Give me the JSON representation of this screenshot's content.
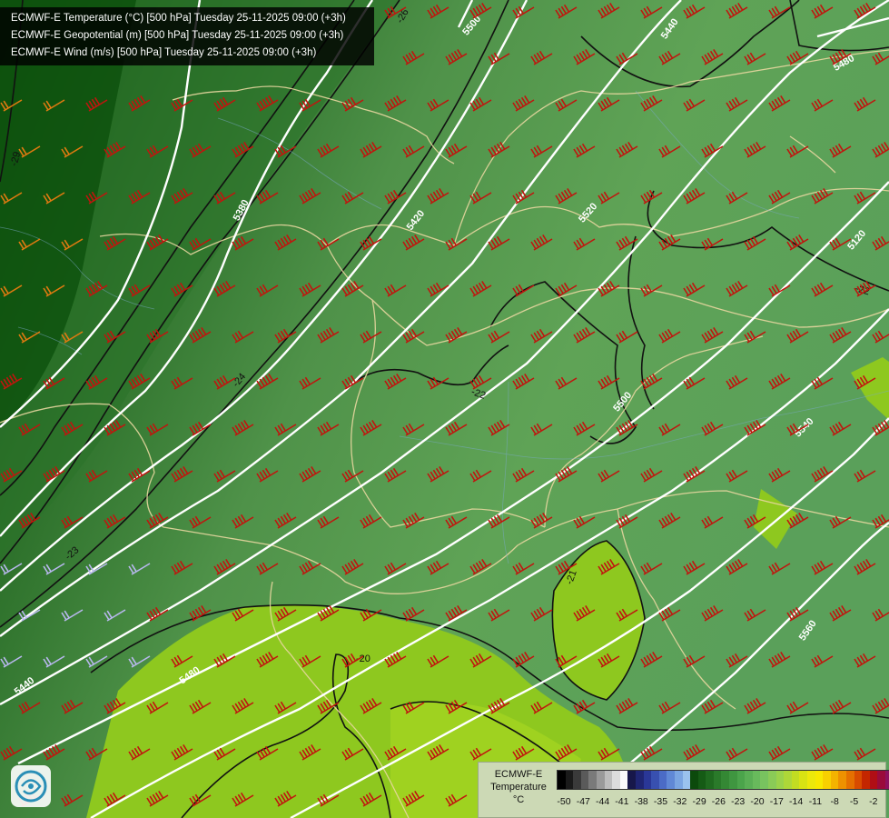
{
  "titles": [
    "ECMWF-E Temperature (°C) [500 hPa] Tuesday 25-11-2025 09:00 (+3h)",
    "ECMWF-E Geopotential (m) [500 hPa] Tuesday 25-11-2025 09:00 (+3h)",
    "ECMWF-E Wind (m/s) [500 hPa] Tuesday 25-11-2025 09:00 (+3h)"
  ],
  "legend": {
    "title_line1": "ECMWF-E",
    "title_line2": "Temperature",
    "unit": "°C",
    "ticks": [
      "-50",
      "-47",
      "-44",
      "-41",
      "-38",
      "-35",
      "-32",
      "-29",
      "-26",
      "-23",
      "-20",
      "-17",
      "-14",
      "-11",
      "-8",
      "-5",
      "-2"
    ],
    "colors": [
      "#000000",
      "#1a1a1a",
      "#3a3a3a",
      "#5a5a5a",
      "#7a7a7a",
      "#9a9a9a",
      "#bdbdbd",
      "#dcdcdc",
      "#fbfbfb",
      "#17174a",
      "#1f2573",
      "#2a3797",
      "#3850b0",
      "#4b6bc6",
      "#6088d6",
      "#7aa5e2",
      "#9ac2ee",
      "#0c4a0c",
      "#155b15",
      "#1f6a1f",
      "#2a7a2a",
      "#348834",
      "#3f9640",
      "#4ba44b",
      "#5aaf55",
      "#68ba5c",
      "#78c35f",
      "#8acb57",
      "#9bd24a",
      "#aed738",
      "#c2dc22",
      "#d8e313",
      "#ece80b",
      "#f8e800",
      "#f8d000",
      "#f4b300",
      "#ee9100",
      "#e57000",
      "#d84b00",
      "#c42600",
      "#b00e15",
      "#9a0b3b",
      "#8c1260",
      "#7e1a85",
      "#7020a8",
      "#6224c8",
      "#5a26dd"
    ]
  },
  "geopotential_labels": [
    "5380",
    "5420",
    "5440",
    "5480",
    "5500",
    "5500",
    "5520",
    "5540",
    "5560",
    "5480",
    "5440",
    "5120"
  ],
  "temperature_labels": [
    "-29",
    "-26",
    "-24",
    "-23",
    "-22",
    "-22",
    "-21",
    "-20"
  ],
  "logo_icon": "ecmwf-logo-icon",
  "fill_colors": {
    "dark": "#1f6a1f",
    "mid": "#3f8a3f",
    "light": "#5aa55a",
    "yellow": "#8fc81f"
  }
}
